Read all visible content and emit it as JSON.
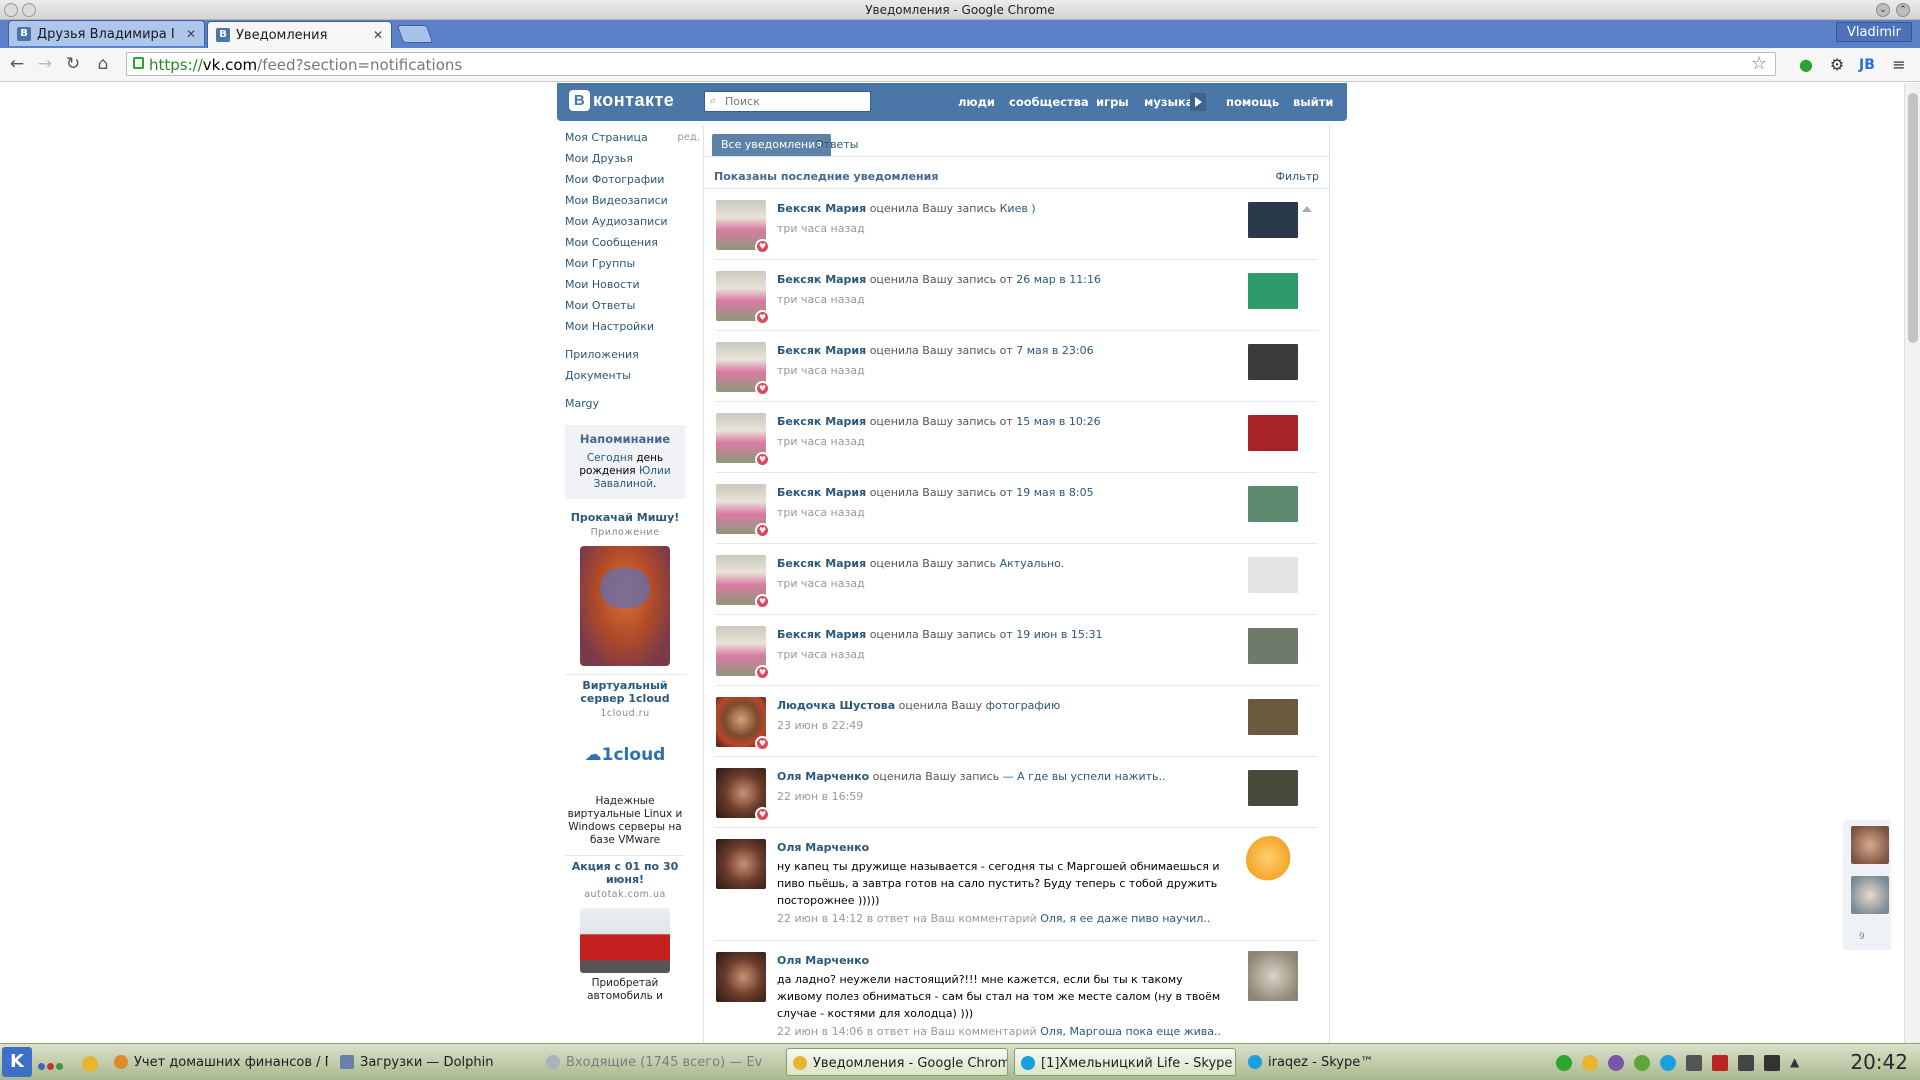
{
  "window": {
    "title": "Уведомления - Google Chrome",
    "user": "Vladimir"
  },
  "tabs": [
    {
      "label": "Друзья Владимира I"
    },
    {
      "label": "Уведомления"
    }
  ],
  "address": {
    "scheme": "https://",
    "host": "vk.com",
    "path": "/feed?section=notifications"
  },
  "vk": {
    "logo": "контакте",
    "logo_letter": "В",
    "search_placeholder": "Поиск",
    "nav": [
      "люди",
      "сообщества",
      "игры",
      "музыка",
      "помощь",
      "выйти"
    ]
  },
  "left_menu": {
    "items": [
      "Моя Страница",
      "Мои Друзья",
      "Мои Фотографии",
      "Мои Видеозаписи",
      "Мои Аудиозаписи",
      "Мои Сообщения",
      "Мои Группы",
      "Мои Новости",
      "Мои Ответы",
      "Мои Настройки"
    ],
    "edit": "ред.",
    "apps": "Приложения",
    "docs": "Документы",
    "margy": "Margy"
  },
  "reminder": {
    "title": "Напоминание",
    "today": "Сегодня",
    "text1": "день рождения",
    "name": "Юлии Завалиной",
    "dot": "."
  },
  "ads": [
    {
      "title": "Прокачай Мишу!",
      "sub": "Приложение"
    },
    {
      "title": "Виртуальный сервер 1cloud",
      "sub": "1cloud.ru",
      "logo": "1cloud",
      "body": "Надежные виртуальные Linux и Windows серверы на базе VMware"
    },
    {
      "title": "Акция с 01 по 30 июня!",
      "sub": "autotak.com.ua",
      "body": "Приобретай автомобиль и"
    }
  ],
  "content": {
    "tab_all": "Все уведомления",
    "tab_replies": "Ответы",
    "shown": "Показаны последние уведомления",
    "filter": "Фильтр"
  },
  "notifications": [
    {
      "name": "Бексяк Мария",
      "action": "оценила Вашу запись",
      "target": "Киев )",
      "time": "три часа назад",
      "thumb": "#2a3a4a"
    },
    {
      "name": "Бексяк Мария",
      "action": "оценила Вашу запись от",
      "target": "26 мар в 11:16",
      "time": "три часа назад",
      "thumb": "#2e9c6a"
    },
    {
      "name": "Бексяк Мария",
      "action": "оценила Вашу запись от",
      "target": "7 мая в 23:06",
      "time": "три часа назад",
      "thumb": "#3b3b3b"
    },
    {
      "name": "Бексяк Мария",
      "action": "оценила Вашу запись от",
      "target": "15 мая в 10:26",
      "time": "три часа назад",
      "thumb": "#a8222a"
    },
    {
      "name": "Бексяк Мария",
      "action": "оценила Вашу запись от",
      "target": "19 мая в 8:05",
      "time": "три часа назад",
      "thumb": "#5d8a6e"
    },
    {
      "name": "Бексяк Мария",
      "action": "оценила Вашу запись",
      "target": "Актуально.",
      "time": "три часа назад",
      "thumb": "#e4e4e4"
    },
    {
      "name": "Бексяк Мария",
      "action": "оценила Вашу запись от",
      "target": "19 июн в 15:31",
      "time": "три часа назад",
      "thumb": "#6e7b6a"
    },
    {
      "name": "Людочка Шустова",
      "action": "оценила Вашу",
      "target": "фотографию",
      "time": "23 июн в 22:49",
      "thumb": "#6b5a3e"
    },
    {
      "name": "Оля Марченко",
      "action": "оценила Вашу запись",
      "target": "— А где вы успели нажить..",
      "time": "22 июн в 16:59",
      "thumb": "#4a4a3a"
    }
  ],
  "comments": [
    {
      "name": "Оля Марченко",
      "text": "ну капец ты дружище называется - сегодня ты с Маргошей обнимаешься и пиво пьёшь, а завтра готов на сало пустить? Буду теперь с тобой дружить посторожнее )))))",
      "time": "22 июн в 14:12 в ответ на Ваш комментарий",
      "reply": "Оля, я ее даже пиво научил.."
    },
    {
      "name": "Оля Марченко",
      "text": "да ладно? неужели настоящий?!!! мне кажется, если бы ты к такому живому полез обниматься - сам бы стал на том же месте салом (ну в твоём случае - костями для холодца) )))",
      "time": "22 июн в 14:06 в ответ на Ваш комментарий",
      "reply": "Оля, Маргоша пока еще жива.."
    }
  ],
  "side_count": "9",
  "taskbar": {
    "tasks": [
      "Учет домашних финансов / Г",
      "Загрузки — Dolphin",
      "Входящие (1745 всего) — Ev",
      "Уведомления - Google Chrom",
      "[1]Хмельницкий Life - Skype",
      "iraqez - Skype™"
    ],
    "clock": "20:42"
  }
}
